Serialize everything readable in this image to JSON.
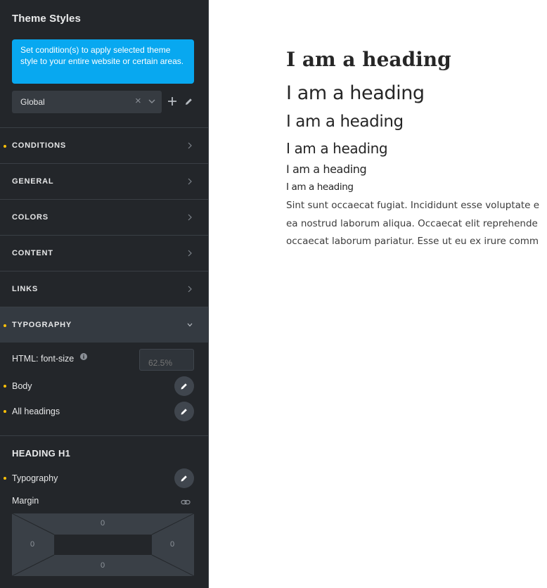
{
  "sidebar": {
    "title": "Theme Styles",
    "notice": "Set condition(s) to apply selected theme style to your entire website or certain areas.",
    "style_select": {
      "value": "Global",
      "clear": "×"
    },
    "sections": [
      {
        "label": "CONDITIONS",
        "has_dot": true,
        "expanded": false
      },
      {
        "label": "GENERAL",
        "has_dot": false,
        "expanded": false
      },
      {
        "label": "COLORS",
        "has_dot": false,
        "expanded": false
      },
      {
        "label": "CONTENT",
        "has_dot": false,
        "expanded": false
      },
      {
        "label": "LINKS",
        "has_dot": false,
        "expanded": false
      },
      {
        "label": "TYPOGRAPHY",
        "has_dot": true,
        "expanded": true
      }
    ],
    "typography": {
      "html_font_size_label": "HTML: font-size",
      "html_font_size_placeholder": "62.5%",
      "body_label": "Body",
      "all_headings_label": "All headings"
    },
    "heading_h1": {
      "title": "HEADING H1",
      "typography_label": "Typography",
      "margin_label": "Margin",
      "margin": {
        "top": "0",
        "right": "0",
        "bottom": "0",
        "left": "0"
      }
    },
    "colors": {
      "accent": "#08a8f0",
      "modified_dot": "#ffc107",
      "panel_bg": "#23262a"
    }
  },
  "preview": {
    "headings": [
      "I am a heading",
      "I am a heading",
      "I am a heading",
      "I am a heading",
      "I am a heading",
      "I am a heading"
    ],
    "paragraph_lines": [
      "Sint sunt occaecat fugiat. Incididunt esse voluptate e",
      "ea nostrud laborum aliqua. Occaecat elit reprehende",
      "occaecat laborum pariatur. Esse ut eu ex irure comm"
    ]
  }
}
